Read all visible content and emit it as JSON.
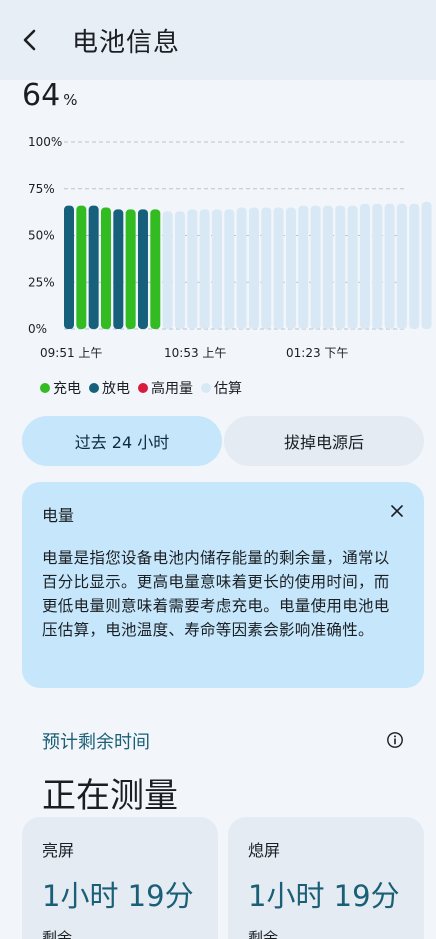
{
  "header": {
    "title": "电池信息"
  },
  "battery": {
    "level": "64",
    "unit": "%"
  },
  "chart_data": {
    "type": "bar",
    "y_ticks": [
      "100%",
      "75%",
      "50%",
      "25%",
      "0%"
    ],
    "x_ticks": [
      "09:51 上午",
      "10:53 上午",
      "01:23 下午"
    ],
    "ylim": [
      0,
      100
    ],
    "series": [
      {
        "name": "充电",
        "color": "#33bb22",
        "values": [
          null,
          66,
          null,
          65,
          null,
          64,
          null,
          64
        ]
      },
      {
        "name": "放电",
        "color": "#17607c",
        "values": [
          66,
          null,
          66,
          null,
          64,
          null,
          64,
          null
        ]
      },
      {
        "name": "高用量",
        "color": "#d71c3e",
        "values": []
      },
      {
        "name": "估算",
        "color": "#d9e8f5",
        "values": [
          null,
          null,
          null,
          null,
          null,
          null,
          null,
          null,
          63,
          63,
          64,
          64,
          64,
          64,
          65,
          65,
          65,
          65,
          65,
          66,
          66,
          66,
          66,
          66,
          67,
          67,
          67,
          67,
          67,
          68
        ]
      }
    ],
    "grid": true
  },
  "legend": [
    {
      "label": "充电",
      "color": "#33bb22"
    },
    {
      "label": "放电",
      "color": "#17607c"
    },
    {
      "label": "高用量",
      "color": "#d71c3e"
    },
    {
      "label": "估算",
      "color": "#d9e8f5"
    }
  ],
  "tabs": {
    "past24": "过去 24 小时",
    "unplugged": "拔掉电源后"
  },
  "info_card": {
    "title": "电量",
    "body": "电量是指您设备电池内储存能量的剩余量，通常以百分比显示。更高电量意味着更长的使用时间，而更低电量则意味着需要考虑充电。电量使用电池电压估算，电池温度、寿命等因素会影响准确性。"
  },
  "estimate": {
    "label": "预计剩余时间",
    "value": "正在测量"
  },
  "screen_on": {
    "label": "亮屏",
    "value": "1小时 19分",
    "sub": "剩余"
  },
  "screen_off": {
    "label": "熄屏",
    "value": "1小时 19分",
    "sub": "剩余"
  }
}
